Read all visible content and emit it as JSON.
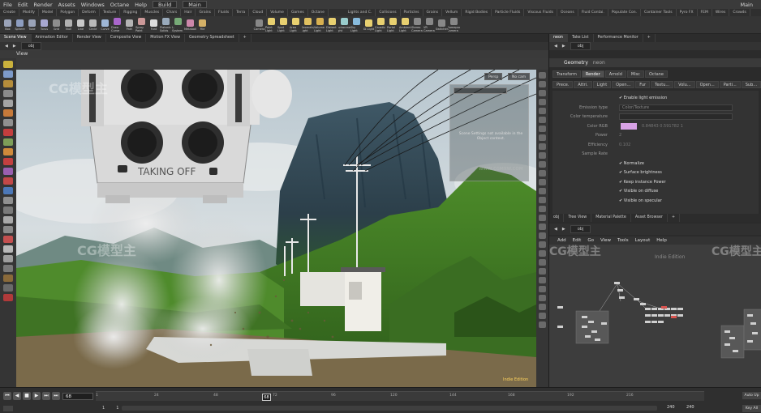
{
  "menubar": {
    "items": [
      "File",
      "Edit",
      "Render",
      "Assets",
      "Windows",
      "Octane",
      "Help"
    ],
    "desktop_left": "Build",
    "desktop_right": "Main",
    "right_label": "Main"
  },
  "shelf_tabs": [
    "Create",
    "Modify",
    "Model",
    "Polygon",
    "Deform",
    "Texture",
    "Rigging",
    "Muscles",
    "Chars",
    "Hair",
    "Grains",
    "Fluids",
    "Terra",
    "Cloud",
    "Volume",
    "Games",
    "Octane",
    "Lights and C.",
    "Collisions",
    "Particles",
    "Grains",
    "Vellum",
    "Rigid Bodies",
    "Particle Fluids",
    "Viscous Fluids",
    "Oceans",
    "Fluid Contai.",
    "Populate Con.",
    "Container Tools",
    "Pyro FX",
    "FEM",
    "Wires",
    "Crowds"
  ],
  "shelf_tools_left": [
    {
      "label": "Box",
      "color": "#9aa3b8"
    },
    {
      "label": "Sphere",
      "color": "#8d9dc0"
    },
    {
      "label": "Tube",
      "color": "#9aa3b8"
    },
    {
      "label": "Torus",
      "color": "#a8a8d0"
    },
    {
      "label": "Grid",
      "color": "#8e8e8e"
    },
    {
      "label": "Null",
      "color": "#b0b0b0"
    },
    {
      "label": "Line",
      "color": "#c8c8c8"
    },
    {
      "label": "Circle",
      "color": "#b8b8b8"
    },
    {
      "label": "Curve",
      "color": "#9fb7d6"
    },
    {
      "label": "Draw Curve",
      "color": "#a6c"
    },
    {
      "label": "Path",
      "color": "#b4b4b4"
    },
    {
      "label": "Spray Paint",
      "color": "#c99"
    },
    {
      "label": "Font",
      "color": "#ddd"
    },
    {
      "label": "Platonic Solids",
      "color": "#9ab"
    },
    {
      "label": "L-System",
      "color": "#7a7"
    },
    {
      "label": "Metaball",
      "color": "#c8a"
    },
    {
      "label": "File",
      "color": "#d4b067"
    }
  ],
  "shelf_tools_right": [
    {
      "label": "Camera",
      "color": "#888"
    },
    {
      "label": "Point Light",
      "color": "#e8d070"
    },
    {
      "label": "Spot Light",
      "color": "#e8d070"
    },
    {
      "label": "Area Light",
      "color": "#e8d070"
    },
    {
      "label": "Geometry Light",
      "color": "#e0c060"
    },
    {
      "label": "Volume Light",
      "color": "#d8b050"
    },
    {
      "label": "Distant Light",
      "color": "#e8d070"
    },
    {
      "label": "Environment Light",
      "color": "#9cc"
    },
    {
      "label": "Sky Light",
      "color": "#8bd"
    },
    {
      "label": "GI Light",
      "color": "#e8d070"
    },
    {
      "label": "Caustic Light",
      "color": "#e8d070"
    },
    {
      "label": "Portal Light",
      "color": "#e8d070"
    },
    {
      "label": "Ambient Light",
      "color": "#e8d070"
    },
    {
      "label": "Stereo Camera",
      "color": "#888"
    },
    {
      "label": "VR Camera",
      "color": "#888"
    },
    {
      "label": "Switcher",
      "color": "#888"
    },
    {
      "label": "Gamepad Camera",
      "color": "#888"
    }
  ],
  "left_pane_tabs": [
    "Scene View",
    "Animation Editor",
    "Render View",
    "Composite View",
    "Motion FX View",
    "Geometry Spreadsheet"
  ],
  "right_pane_tabs": [
    "neon",
    "Take List",
    "Performance Monitor"
  ],
  "network_path": "obj",
  "viewport": {
    "title": "View",
    "persp_label": "Persp",
    "cam_label": "No cam",
    "display_message": "Scene Settings not available in the Object context.",
    "indie_label": "Indie Edition",
    "pod_label": "TAKING OFF"
  },
  "param_panel": {
    "node_type": "Geometry",
    "node_name": "neon",
    "tabs": [
      "Transform",
      "Render",
      "Arnold",
      "Misc",
      "Octane"
    ],
    "active_tab": "Render",
    "sub_tabs": [
      "Prece.",
      "Attri.",
      "Light",
      "Open...",
      "Fur",
      "Textu...",
      "Volu...",
      "Open...",
      "Parti...",
      "Sub..."
    ],
    "rows": [
      {
        "label": "",
        "type": "check",
        "value": "Enable light emission"
      },
      {
        "label": "Emission type",
        "type": "box",
        "value": "Color/Texture"
      },
      {
        "label": "Color temperature",
        "type": "box",
        "value": ""
      },
      {
        "label": "Color RGB",
        "type": "color",
        "value": "0.84843    0.591782    1"
      },
      {
        "label": "Power",
        "type": "text",
        "value": "2"
      },
      {
        "label": "Efficiency",
        "type": "text",
        "value": "0.102"
      },
      {
        "label": "Sample Rate",
        "type": "text",
        "value": ""
      },
      {
        "label": "",
        "type": "check",
        "value": "Normalize"
      },
      {
        "label": "",
        "type": "check",
        "value": "Surface brightness"
      },
      {
        "label": "",
        "type": "check",
        "value": "Keep instance Power"
      },
      {
        "label": "",
        "type": "check",
        "value": "Visible on diffuse"
      },
      {
        "label": "",
        "type": "check",
        "value": "Visible on specular"
      }
    ]
  },
  "network_pane_tabs": [
    "obj",
    "Tree View",
    "Material Palette",
    "Asset Browser"
  ],
  "network_menu": [
    "Add",
    "Edit",
    "Go",
    "View",
    "Tools",
    "Layout",
    "Help"
  ],
  "network_indie": "Indie Edition",
  "watermarks": [
    "CG模型主",
    "CG模型主",
    "CG模型主",
    "CG模型主",
    "CG模型主"
  ],
  "watermark_url": "WWW.CGMXW.COM",
  "timeline": {
    "current_frame": "68",
    "cursor_frame": "68",
    "ticks": [
      "24",
      "48",
      "72",
      "96",
      "120",
      "144",
      "168",
      "192",
      "216"
    ],
    "range_start": "1",
    "range_start2": "1",
    "range_end": "240",
    "range_end2": "240",
    "key_label": "Auto Up",
    "key_label2": "Key All"
  },
  "colors": {
    "accent_orange": "#e08a1e",
    "indie_yellow": "#ffd45e",
    "light_swatch": "#d8a2e6"
  }
}
